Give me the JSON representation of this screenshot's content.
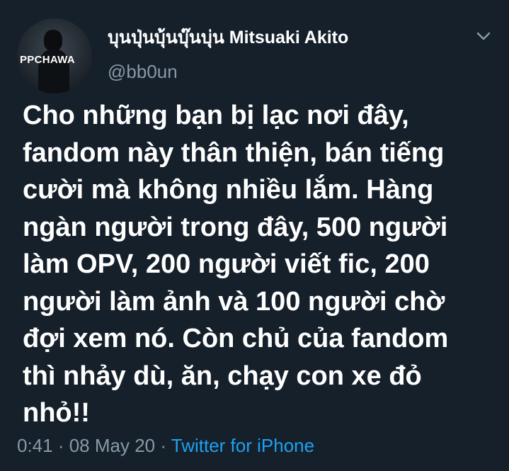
{
  "tweet": {
    "display_name": "บุนปุ่นบุ้นบุ๊นบุ่น Mitsuaki Akito",
    "handle": "@bb0un",
    "avatar_text": "PPCHAWA",
    "text": "Cho những bạn bị lạc nơi đây,\nfandom này thân thiện, bán tiếng\ncười mà không nhiều lắm. Hàng\nngàn người trong đây, 500 người\nlàm OPV, 200 người viết fic, 200\nngười làm ảnh và 100 người chờ\nđợi xem nó. Còn chủ của fandom\nthì nhảy dù, ăn, chạy con xe đỏ\nnhỏ!!",
    "time": "0:41",
    "separator": " · ",
    "date": "08 May 20",
    "source": "Twitter for iPhone",
    "menu_icon": "chevron-down-icon"
  },
  "colors": {
    "background": "#15202b",
    "primary_text": "#ffffff",
    "secondary_text": "#8899a6",
    "link": "#1da1f2"
  }
}
